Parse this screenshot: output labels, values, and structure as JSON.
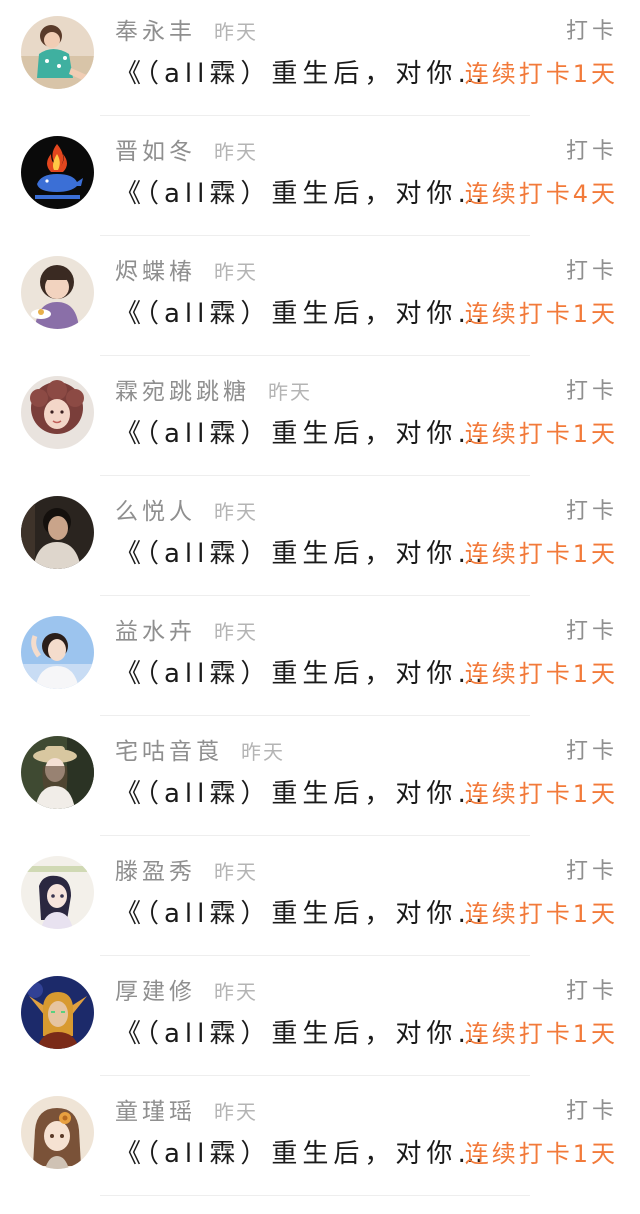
{
  "colors": {
    "name": "#8f8f8f",
    "time": "#b4b4b4",
    "title": "#1a1a1a",
    "streak": "#f27a3a",
    "divider": "#eeeeee"
  },
  "entries": [
    {
      "name": "奉永丰",
      "time": "昨天",
      "action": "打卡",
      "title": "《（all霖）重生后，对你…",
      "streak": "连续打卡1天",
      "avatar_icon": "avatar-girl-sitting-icon"
    },
    {
      "name": "晋如冬",
      "time": "昨天",
      "action": "打卡",
      "title": "《（all霖）重生后，对你…",
      "streak": "连续打卡4天",
      "avatar_icon": "avatar-fire-whale-icon"
    },
    {
      "name": "烬蝶椿",
      "time": "昨天",
      "action": "打卡",
      "title": "《（all霖）重生后，对你…",
      "streak": "连续打卡1天",
      "avatar_icon": "avatar-boy-eating-icon"
    },
    {
      "name": "霖宛跳跳糖",
      "time": "昨天",
      "action": "打卡",
      "title": "《（all霖）重生后，对你…",
      "streak": "连续打卡1天",
      "avatar_icon": "avatar-curly-hair-icon"
    },
    {
      "name": "么悦人",
      "time": "昨天",
      "action": "打卡",
      "title": "《（all霖）重生后，对你…",
      "streak": "连续打卡1天",
      "avatar_icon": "avatar-dark-portrait-icon"
    },
    {
      "name": "益水卉",
      "time": "昨天",
      "action": "打卡",
      "title": "《（all霖）重生后，对你…",
      "streak": "连续打卡1天",
      "avatar_icon": "avatar-blue-sky-icon"
    },
    {
      "name": "宅咕音莨",
      "time": "昨天",
      "action": "打卡",
      "title": "《（all霖）重生后，对你…",
      "streak": "连续打卡1天",
      "avatar_icon": "avatar-hat-girl-icon"
    },
    {
      "name": "滕盈秀",
      "time": "昨天",
      "action": "打卡",
      "title": "《（all霖）重生后，对你…",
      "streak": "连续打卡1天",
      "avatar_icon": "avatar-anime-girl-icon"
    },
    {
      "name": "厚建修",
      "time": "昨天",
      "action": "打卡",
      "title": "《（all霖）重生后，对你…",
      "streak": "连续打卡1天",
      "avatar_icon": "avatar-fantasy-elf-icon"
    },
    {
      "name": "童瑾瑶",
      "time": "昨天",
      "action": "打卡",
      "title": "《（all霖）重生后，对你…",
      "streak": "连续打卡1天",
      "avatar_icon": "avatar-anime-flower-icon"
    }
  ]
}
